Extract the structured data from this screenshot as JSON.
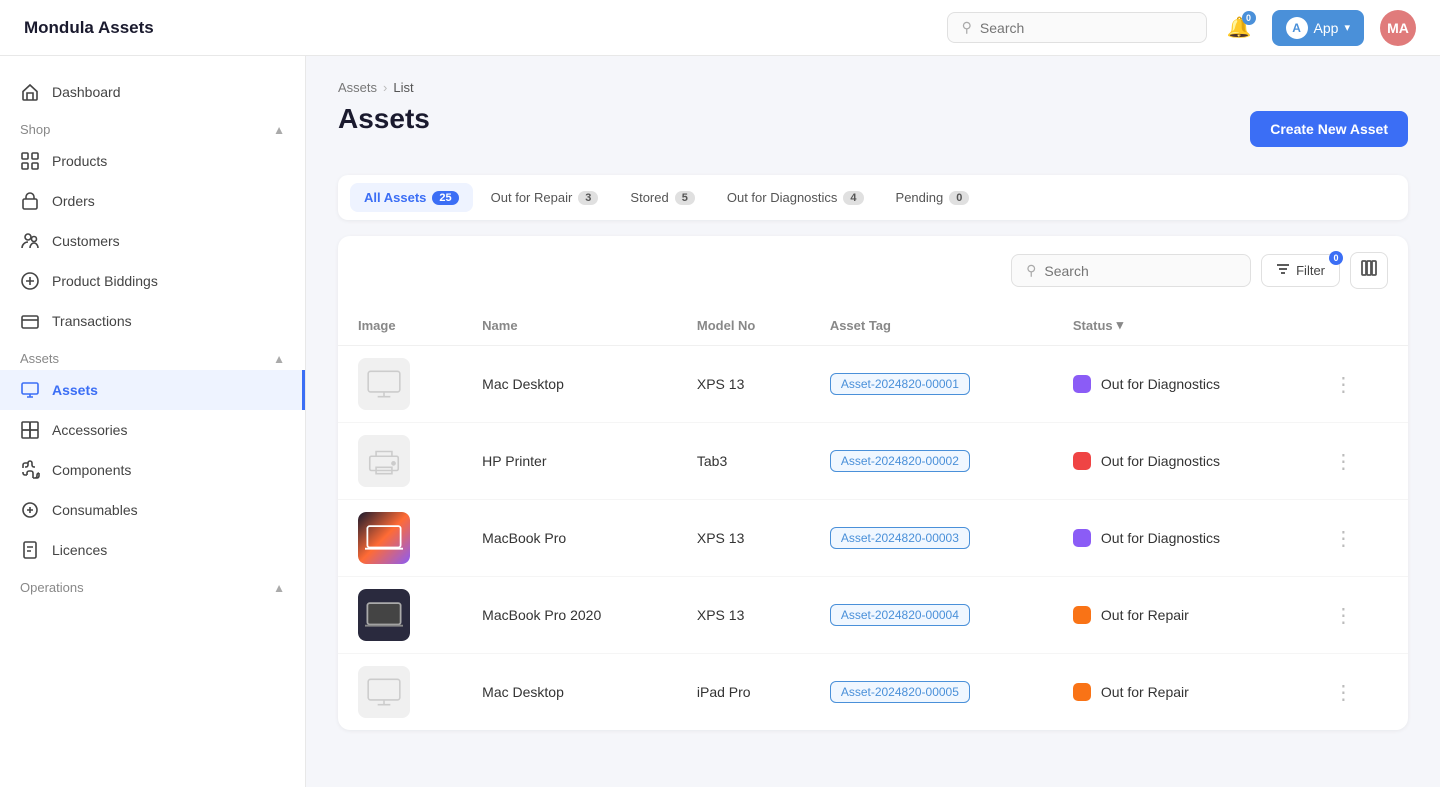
{
  "app": {
    "logo": "Mondula Assets",
    "user_initials": "MA",
    "app_button_label": "App",
    "app_button_icon": "A",
    "notification_count": "0"
  },
  "header_search": {
    "placeholder": "Search"
  },
  "breadcrumb": {
    "root": "Assets",
    "current": "List"
  },
  "page": {
    "title": "Assets",
    "create_button": "Create New Asset"
  },
  "tabs": [
    {
      "id": "all",
      "label": "All Assets",
      "count": "25",
      "active": true
    },
    {
      "id": "repair",
      "label": "Out for Repair",
      "count": "3",
      "active": false
    },
    {
      "id": "stored",
      "label": "Stored",
      "count": "5",
      "active": false
    },
    {
      "id": "diagnostics",
      "label": "Out for Diagnostics",
      "count": "4",
      "active": false
    },
    {
      "id": "pending",
      "label": "Pending",
      "count": "0",
      "active": false
    }
  ],
  "table_search": {
    "placeholder": "Search"
  },
  "filter_button": "Filter",
  "filter_count": "0",
  "table": {
    "columns": [
      "Image",
      "Name",
      "Model No",
      "Asset Tag",
      "Status"
    ],
    "rows": [
      {
        "name": "Mac Desktop",
        "model": "XPS 13",
        "tag": "Asset-2024820-00001",
        "status": "Out for Diagnostics",
        "status_color": "purple",
        "img_type": "monitor"
      },
      {
        "name": "HP Printer",
        "model": "Tab3",
        "tag": "Asset-2024820-00002",
        "status": "Out for Diagnostics",
        "status_color": "red",
        "img_type": "printer"
      },
      {
        "name": "MacBook Pro",
        "model": "XPS 13",
        "tag": "Asset-2024820-00003",
        "status": "Out for Diagnostics",
        "status_color": "purple",
        "img_type": "laptop"
      },
      {
        "name": "MacBook Pro 2020",
        "model": "XPS 13",
        "tag": "Asset-2024820-00004",
        "status": "Out for Repair",
        "status_color": "orange",
        "img_type": "laptop2"
      },
      {
        "name": "Mac Desktop",
        "model": "iPad Pro",
        "tag": "Asset-2024820-00005",
        "status": "Out for Repair",
        "status_color": "orange",
        "img_type": "monitor"
      }
    ]
  },
  "sidebar": {
    "sections": [
      {
        "label": "Shop",
        "items": [
          {
            "id": "products",
            "label": "Products",
            "icon": "grid"
          },
          {
            "id": "orders",
            "label": "Orders",
            "icon": "bag"
          },
          {
            "id": "customers",
            "label": "Customers",
            "icon": "people"
          },
          {
            "id": "product-biddings",
            "label": "Product Biddings",
            "icon": "star"
          },
          {
            "id": "transactions",
            "label": "Transactions",
            "icon": "card"
          }
        ]
      },
      {
        "label": "Assets",
        "items": [
          {
            "id": "assets",
            "label": "Assets",
            "icon": "monitor",
            "active": true
          },
          {
            "id": "accessories",
            "label": "Accessories",
            "icon": "tag"
          },
          {
            "id": "components",
            "label": "Components",
            "icon": "puzzle"
          },
          {
            "id": "consumables",
            "label": "Consumables",
            "icon": "box"
          },
          {
            "id": "licences",
            "label": "Licences",
            "icon": "doc"
          }
        ]
      },
      {
        "label": "Operations",
        "items": []
      }
    ]
  }
}
